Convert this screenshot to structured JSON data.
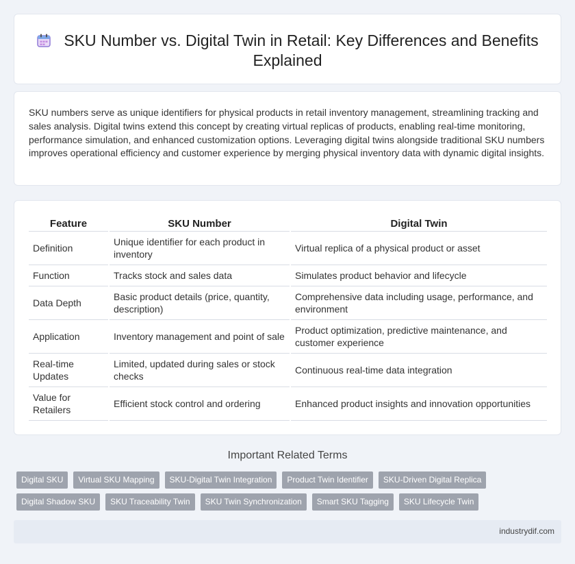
{
  "header": {
    "title": "SKU Number vs. Digital Twin in Retail: Key Differences and Benefits Explained",
    "icon": "calendar-icon"
  },
  "intro": {
    "text": "SKU numbers serve as unique identifiers for physical products in retail inventory management, streamlining tracking and sales analysis. Digital twins extend this concept by creating virtual replicas of products, enabling real-time monitoring, performance simulation, and enhanced customization options. Leveraging digital twins alongside traditional SKU numbers improves operational efficiency and customer experience by merging physical inventory data with dynamic digital insights."
  },
  "table": {
    "headers": [
      "Feature",
      "SKU Number",
      "Digital Twin"
    ],
    "rows": [
      [
        "Definition",
        "Unique identifier for each product in inventory",
        "Virtual replica of a physical product or asset"
      ],
      [
        "Function",
        "Tracks stock and sales data",
        "Simulates product behavior and lifecycle"
      ],
      [
        "Data Depth",
        "Basic product details (price, quantity, description)",
        "Comprehensive data including usage, performance, and environment"
      ],
      [
        "Application",
        "Inventory management and point of sale",
        "Product optimization, predictive maintenance, and customer experience"
      ],
      [
        "Real-time Updates",
        "Limited, updated during sales or stock checks",
        "Continuous real-time data integration"
      ],
      [
        "Value for Retailers",
        "Efficient stock control and ordering",
        "Enhanced product insights and innovation opportunities"
      ]
    ]
  },
  "related": {
    "heading": "Important Related Terms",
    "row1": [
      "Digital SKU",
      "Virtual SKU Mapping",
      "SKU-Digital Twin Integration",
      "Product Twin Identifier",
      "SKU-Driven Digital Replica"
    ],
    "row2": [
      "Digital Shadow SKU",
      "SKU Traceability Twin",
      "SKU Twin Synchronization",
      "Smart SKU Tagging",
      "SKU Lifecycle Twin"
    ]
  },
  "footer": {
    "site": "industrydif.com"
  },
  "colors": {
    "background": "#f0f3f8",
    "tag_bg": "#9ea3ad",
    "footer_bg": "#e6ebf3"
  }
}
